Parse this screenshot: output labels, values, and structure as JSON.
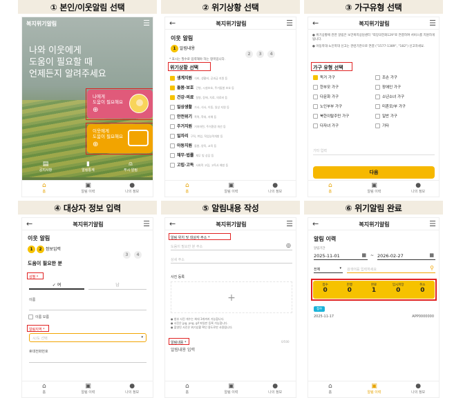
{
  "panels": {
    "p1": {
      "title": "① 본인/이웃알림 선택"
    },
    "p2": {
      "title": "② 위기상황 선택"
    },
    "p3": {
      "title": "③ 가구유형 선택"
    },
    "p4": {
      "title": "④ 대상자 정보 입력"
    },
    "p5": {
      "title": "⑤ 알림내용 작성"
    },
    "p6": {
      "title": "⑥ 위기알림 완료"
    }
  },
  "brand": "복지위기알림",
  "nav": {
    "home": "홈",
    "history": "알림 이력",
    "my": "나의 정보"
  },
  "s1": {
    "hero_line1": "나와 이웃에게",
    "hero_line2": "도움이 필요할 때",
    "hero_line3": "언제든지 알려주세요",
    "card1_l1": "나에게",
    "card1_l2": "도움이 필요해요",
    "card2_l1": "이웃에게",
    "card2_l2": "도움이 필요해요",
    "q1": "공지사항",
    "q2": "알림통계",
    "q3": "푸시 알림"
  },
  "s2": {
    "page_title": "이웃 알림",
    "step1": "1",
    "step_label": "알림내용",
    "step2": "2",
    "step3": "3",
    "step4": "4",
    "required_note": "* 표시는 필수로 입력해야 하는 항목입니다.",
    "section_label": "위기상황 선택",
    "items": [
      {
        "name": "생계지원",
        "desc": "식비, 생활비, 공과금 지원 등",
        "checked": true
      },
      {
        "name": "돌봄·보호",
        "desc": "간병, 시설보호, 주거돌봄 보호 등",
        "checked": true
      },
      {
        "name": "건강·의료",
        "desc": "질병, 장애, 치료, 의료비 등",
        "checked": true
      },
      {
        "name": "일상생활",
        "desc": "가사, 식사, 이동, 일상 지원 등",
        "checked": false
      },
      {
        "name": "안전위기",
        "desc": "폭력, 학대, 자해 등",
        "checked": false
      },
      {
        "name": "주거지원",
        "desc": "거처마련, 주거환경 개선 등",
        "checked": false
      },
      {
        "name": "일자리",
        "desc": "구직, 취업, 직업능력개발 등",
        "checked": false
      },
      {
        "name": "아동지원",
        "desc": "돌봄, 양육, 교육 등",
        "checked": false
      },
      {
        "name": "채무·법률",
        "desc": "채무 빚 상담 등",
        "checked": false
      },
      {
        "name": "고립·고독",
        "desc": "사회적 고립, 고독사 예방 등",
        "checked": false
      }
    ]
  },
  "s3": {
    "notice1": "위기상황에 관한 알림은 보건복지상담센터 \"희망의전화129\"로 연결하여 서비스를 지원하게 됩니다.",
    "notice2": "아동학대·노인학대 신고는 관련기관으로 연결 (\"1577-1389\", \"182\") 신고하세요.",
    "section_label": "가구 유형 선택",
    "items": [
      {
        "name": "독거 가구",
        "checked": true
      },
      {
        "name": "조손 가구",
        "checked": false
      },
      {
        "name": "한부모 가구",
        "checked": false
      },
      {
        "name": "장애인 가구",
        "checked": false
      },
      {
        "name": "다문화 가구",
        "checked": false
      },
      {
        "name": "소년소녀 가구",
        "checked": false
      },
      {
        "name": "노인부부 가구",
        "checked": false
      },
      {
        "name": "미혼모/부 가구",
        "checked": false
      },
      {
        "name": "북한이탈주민 가구",
        "checked": false
      },
      {
        "name": "일반 가구",
        "checked": false
      },
      {
        "name": "다자녀 가구",
        "checked": false
      },
      {
        "name": "기타",
        "checked": false
      }
    ],
    "etc_placeholder": "기타 입력",
    "next": "다음"
  },
  "s4": {
    "page_title": "이웃 알림",
    "step1": "1",
    "step2": "2",
    "step_label": "정보입력",
    "step3": "3",
    "step4": "4",
    "section": "도움이 필요한 분",
    "gender_label": "성별 *",
    "male": "여",
    "female": "남",
    "name_label": "이름",
    "name_unknown": "이름 모름",
    "region_label": "알림지역 *",
    "region_placeholder": "시/도 선택",
    "phone_label": "휴대전화번호"
  },
  "s5": {
    "addr_label": "알림 위치 및 대상자 주소 *",
    "addr_placeholder": "도움이 필요한 분 주소",
    "addr_detail": "상세 주소",
    "photo_label": "사진 등록",
    "note1": "첨부 사진 개수는 최대 3개까지 가능합니다.",
    "note2": "사진은 jpg, png, gif 파일만 등록 가능합니다.",
    "note3": "촬영된 사진은 위기상황 확인 용도로만 사용됩니다.",
    "content_label": "알림내용 *",
    "content_count": "0/500",
    "content_placeholder": "알림내용 입력"
  },
  "s6": {
    "title": "알림 이력",
    "period_label": "알림기간",
    "start": "2025-11-01",
    "tilde": "~",
    "end": "2026-02-27",
    "filter": "전체",
    "search_placeholder": "검색어를 입력하세요",
    "stats": [
      {
        "label": "접수",
        "value": "0"
      },
      {
        "label": "진행",
        "value": "0"
      },
      {
        "label": "완료",
        "value": "1"
      },
      {
        "label": "임시저장",
        "value": "0"
      },
      {
        "label": "취소",
        "value": "0"
      }
    ],
    "badge": "접수",
    "row_date": "2025-11-17",
    "row_id": "APP0000000"
  },
  "colors": {
    "accent": "#f6c200",
    "red_highlight": "#e02020",
    "card_teal": "#e05a7a",
    "card_orange": "#f2a400"
  }
}
